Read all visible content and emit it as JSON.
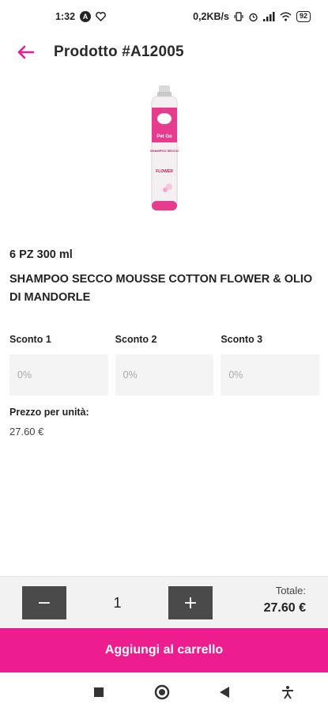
{
  "status_bar": {
    "time": "1:32",
    "network_speed": "0,2KB/s",
    "battery": "92",
    "icons": [
      "app-notification-icon",
      "heart-icon",
      "vibrate-icon",
      "alarm-icon",
      "signal-icon",
      "wifi-icon",
      "battery-icon"
    ]
  },
  "header": {
    "title": "Prodotto  #A12005",
    "back_icon": "arrow-left-icon"
  },
  "product": {
    "quantity_label": "6 PZ 300 ml",
    "name": "SHAMPOO SECCO MOUSSE COTTON FLOWER & OLIO DI MANDORLE",
    "image_brand_text": "Pet Go",
    "image_product_text": "SHAMPOO SECCO",
    "image_variant_text": "FLOWER"
  },
  "discounts": [
    {
      "label": "Sconto 1",
      "placeholder": "0%"
    },
    {
      "label": "Sconto 2",
      "placeholder": "0%"
    },
    {
      "label": "Sconto 3",
      "placeholder": "0%"
    }
  ],
  "unit_price": {
    "label": "Prezzo per unità:",
    "value": "27.60 €"
  },
  "cart_controls": {
    "minus_label": "−",
    "quantity": "1",
    "plus_label": "+",
    "total_label": "Totale:",
    "total_value": "27.60 €"
  },
  "add_to_cart": {
    "label": "Aggiungi al carrello"
  },
  "colors": {
    "accent": "#ED1C8F",
    "quantity_button": "#4A4A4A",
    "input_background": "#F4F4F4"
  },
  "nav_bar": {
    "icons": [
      "square-recents-icon",
      "circle-home-icon",
      "triangle-back-icon",
      "accessibility-icon"
    ]
  }
}
